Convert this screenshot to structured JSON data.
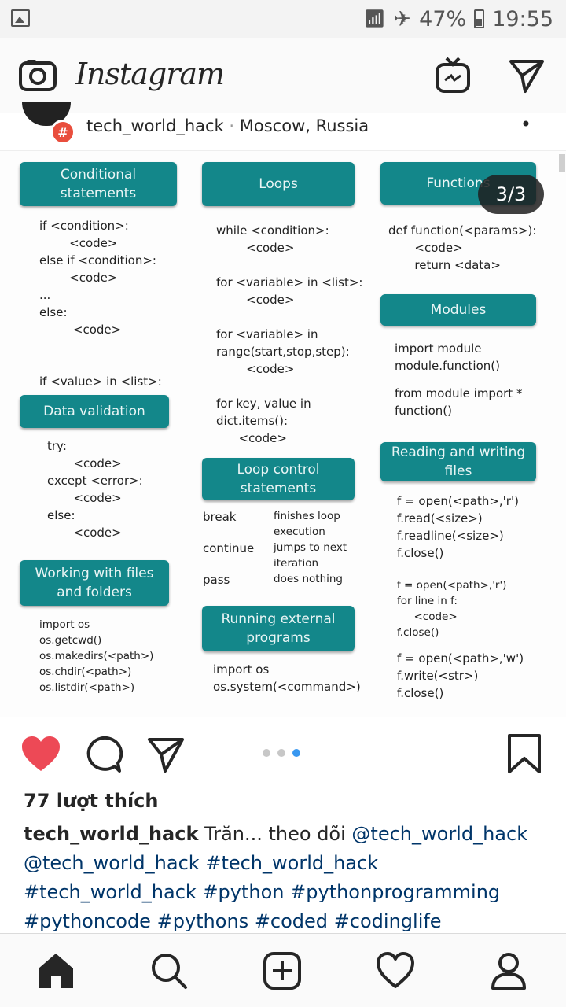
{
  "status_bar": {
    "battery": "47%",
    "time": "19:55"
  },
  "header": {
    "app_title": "Instagram"
  },
  "post": {
    "username": "tech_world_hack",
    "location": "Moscow, Russia",
    "more": "•",
    "image_counter": "3/3",
    "carousel": {
      "count": 3,
      "active_index": 2
    },
    "likes": "77 lượt thích",
    "caption_user": "tech_world_hack",
    "caption_text": " Trăn... theo dõi ",
    "caption_tags": [
      "@tech_world_hack",
      "@tech_world_hack",
      "#tech_world_hack",
      "#tech_world_hack",
      "#python",
      "#pythonprogramming",
      "#pythoncode",
      "#pythons",
      "#coded",
      "#codinglife"
    ]
  },
  "cheatsheet": {
    "box_conditional": "Conditional statements",
    "code_conditional": "if <condition>:\n        <code>\nelse if <condition>:\n        <code>\n...\nelse:\n         <code>\n\n\nif <value> in <list>:",
    "box_data_validation": "Data validation",
    "code_data_validation": "try:\n       <code>\nexcept <error>:\n       <code>\nelse:\n       <code>",
    "box_files": "Working with files and folders",
    "code_files": "import os\nos.getcwd()\nos.makedirs(<path>)\nos.chdir(<path>)\nos.listdir(<path>)",
    "box_loops": "Loops",
    "code_loops": "while <condition>:\n        <code>\n\nfor <variable> in <list>:\n        <code>\n\nfor <variable> in\nrange(start,stop,step):\n        <code>\n\nfor key, value in\ndict.items():\n      <code>",
    "box_loop_control": "Loop control statements",
    "loop_control": [
      {
        "keyword": "break",
        "desc": "finishes loop\nexecution"
      },
      {
        "keyword": "continue",
        "desc": "jumps to next\niteration"
      },
      {
        "keyword": "pass",
        "desc": "does nothing"
      }
    ],
    "box_running": "Running external programs",
    "code_running": "import os\nos.system(<command>)",
    "box_functions": "Functions",
    "code_functions": "def function(<params>):\n       <code>\n       return <data>",
    "box_modules": "Modules",
    "code_modules_1": "import module\nmodule.function()",
    "code_modules_2": "from module import *\nfunction()",
    "box_reading": "Reading and writing files",
    "code_reading_1": "f = open(<path>,'r')\nf.read(<size>)\nf.readline(<size>)\nf.close()",
    "code_reading_2": "f = open(<path>,'r')\nfor line in f:\n     <code>\nf.close()",
    "code_reading_3": "f = open(<path>,'w')\nf.write(<str>)\nf.close()"
  }
}
